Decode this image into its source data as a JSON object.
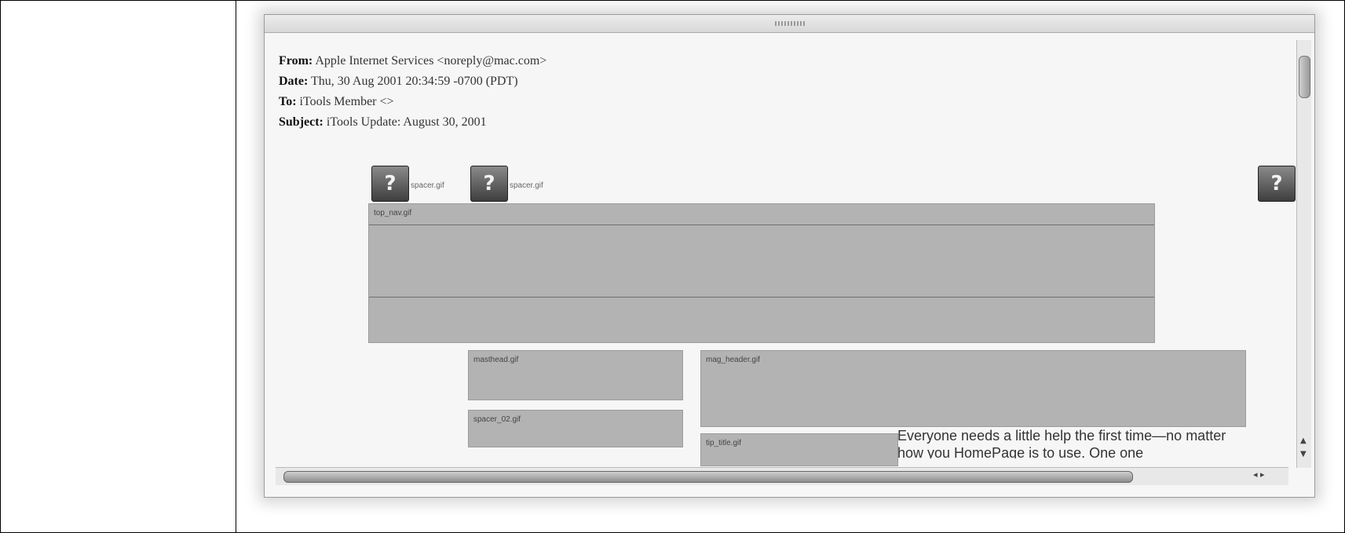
{
  "email": {
    "from_label": "From:",
    "from_value": "Apple Internet Services <noreply@mac.com>",
    "date_label": "Date:",
    "date_value": "Thu, 30 Aug 2001 20:34:59 -0700 (PDT)",
    "to_label": "To:",
    "to_value": "iTools Member <>",
    "subject_label": "Subject:",
    "subject_value": "iTools Update: August 30, 2001"
  },
  "broken_images": {
    "icon_glyph": "?",
    "label_1": "spacer.gif",
    "label_2": "spacer.gif"
  },
  "body": {
    "box1_label": "top_nav.gif",
    "box2_label": "masthead.gif",
    "box3_label": "spacer_02.gif",
    "box4_label": "mag_header.gif",
    "box5_label": "tip_title.gif",
    "body_text": "Everyone needs a little help the first time—no matter how you HomePage is to use. One one"
  },
  "scrollbars": {
    "up_arrow": "▲",
    "down_arrow": "▼",
    "h_arrows": "◂ ▸"
  }
}
